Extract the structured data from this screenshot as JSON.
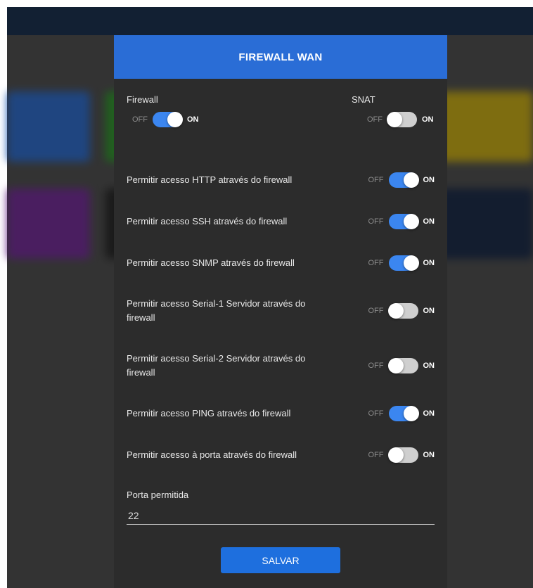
{
  "modal": {
    "title": "FIREWALL WAN",
    "firewall": {
      "label": "Firewall",
      "off_label": "OFF",
      "on_label": "ON",
      "checked": true
    },
    "snat": {
      "label": "SNAT",
      "off_label": "OFF",
      "on_label": "ON",
      "checked": false
    },
    "rules": [
      {
        "label": "Permitir acesso HTTP através do firewall",
        "off_label": "OFF",
        "on_label": "ON",
        "checked": true
      },
      {
        "label": "Permitir acesso SSH através do firewall",
        "off_label": "OFF",
        "on_label": "ON",
        "checked": true
      },
      {
        "label": "Permitir acesso SNMP através do firewall",
        "off_label": "OFF",
        "on_label": "ON",
        "checked": true
      },
      {
        "label": "Permitir acesso Serial-1 Servidor através do firewall",
        "off_label": "OFF",
        "on_label": "ON",
        "checked": false
      },
      {
        "label": "Permitir acesso Serial-2 Servidor através do firewall",
        "off_label": "OFF",
        "on_label": "ON",
        "checked": false
      },
      {
        "label": "Permitir acesso PING através do firewall",
        "off_label": "OFF",
        "on_label": "ON",
        "checked": true
      },
      {
        "label": "Permitir acesso à porta através do firewall",
        "off_label": "OFF",
        "on_label": "ON",
        "checked": false
      }
    ],
    "port_field": {
      "label": "Porta permitida",
      "value": "22"
    },
    "save_label": "SALVAR"
  },
  "colors": {
    "header": "#2a6dd6",
    "modal_bg": "#2c2c2c",
    "switch_on": "#3b86f0",
    "switch_off": "#cfcfcf",
    "save_button": "#1e6fde"
  }
}
